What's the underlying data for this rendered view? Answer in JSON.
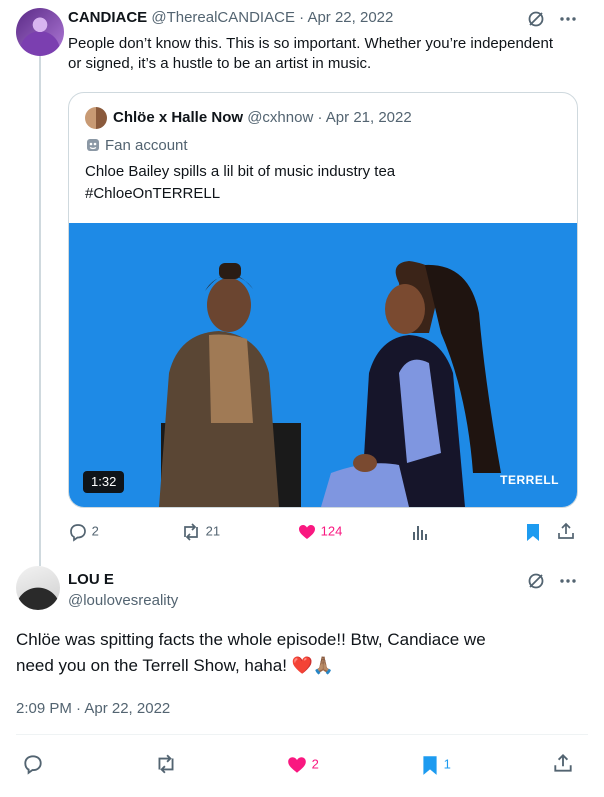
{
  "tweet1": {
    "author_name": "CANDIACE",
    "handle": "@TherealCANDIACE",
    "date": "· Apr 22, 2022",
    "text": "People don’t know this. This is so important. Whether you’re independent or signed, it’s a hustle to be an artist in music.",
    "quote": {
      "author_name": "Chlöe x Halle Now",
      "handle": "@cxhnow",
      "date": "· Apr 21, 2022",
      "label": "Fan account",
      "text_line1": "Chloe Bailey spills a lil bit of music industry tea",
      "text_line2": "#ChloeOnTERRELL",
      "duration": "1:32",
      "brand": "TERRELL"
    },
    "actions": {
      "replies": "2",
      "reposts": "21",
      "likes": "124"
    }
  },
  "tweet2": {
    "author_name": "LOU E",
    "handle": "@loulovesreality",
    "text_line1": "Chlöe was spitting facts the whole episode!! Btw, Candiace we",
    "text_line2": "need you on the Terrell Show, haha! ❤️🙏🏽",
    "timestamp": "2:09 PM · Apr 22, 2022",
    "actions": {
      "likes": "2",
      "bookmarks": "1"
    }
  },
  "colors": {
    "like": "#f91880",
    "bookmark": "#1d9bf0",
    "muted": "#536471",
    "media_bg": "#1e8ae6"
  },
  "icons": [
    "reply-icon",
    "repost-icon",
    "heart-icon",
    "analytics-icon",
    "bookmark-icon",
    "share-icon",
    "grok-icon",
    "more-icon",
    "fan-account-icon"
  ]
}
